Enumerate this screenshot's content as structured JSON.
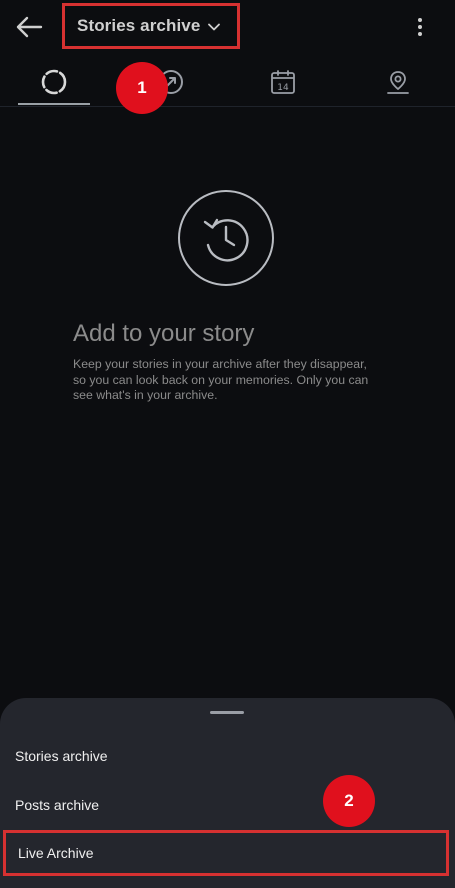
{
  "header": {
    "title": "Stories archive",
    "icons": {
      "back": "arrow-left-icon",
      "dropdown": "chevron-down-icon",
      "more": "more-vertical-icon"
    }
  },
  "tabs": [
    {
      "name": "stories",
      "icon": "story-ring-icon",
      "selected": true
    },
    {
      "name": "posts",
      "icon": "posts-icon",
      "selected": false
    },
    {
      "name": "calendar",
      "icon": "calendar-icon",
      "label": "14",
      "selected": false
    },
    {
      "name": "map",
      "icon": "map-pin-icon",
      "selected": false
    }
  ],
  "annotations": {
    "step1": "1",
    "step2": "2",
    "color": "#e0101d",
    "highlight_color": "#d63131"
  },
  "empty_state": {
    "icon": "history-icon",
    "title": "Add to your story",
    "body": "Keep your stories in your archive after they disappear, so you can look back on your memories. Only you can see what's in your archive."
  },
  "sheet": {
    "items": [
      {
        "label": "Stories archive"
      },
      {
        "label": "Posts archive"
      },
      {
        "label": "Live Archive",
        "highlighted": true
      }
    ]
  },
  "colors": {
    "background": "#0c0d10",
    "sheet": "#24262d",
    "text_muted": "#8b8b8b"
  }
}
